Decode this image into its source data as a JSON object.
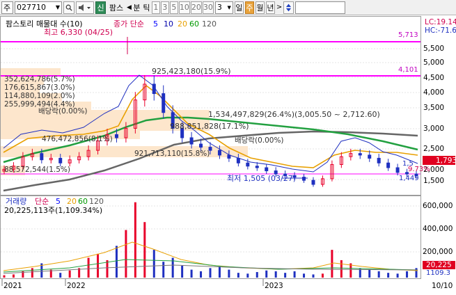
{
  "toolbar": {
    "market_label": "주",
    "code": "027710",
    "new_label": "신",
    "name": "팜스",
    "divide_label": "분",
    "tick_label": "틱",
    "intervals": [
      "1",
      "3",
      "5",
      "10",
      "20",
      "30"
    ],
    "count": "3",
    "day_label": "일",
    "week_label": "주",
    "month_label": "월",
    "year_label": "년",
    "prev_arrow": "◀",
    "next_arrow": ">"
  },
  "price_panel": {
    "legend_name": "팜스토리 매물대 수(10)",
    "legend_ma_prefix": "종가 단순",
    "ma_periods": [
      "5",
      "10",
      "20",
      "60",
      "120"
    ],
    "ma_colors": [
      "#0000ff",
      "#0000aa",
      "#e8a000",
      "#009900",
      "#555555"
    ],
    "high_label": "최고 6,330 (04/25)",
    "low_label": "최저 1,505 (03/27)",
    "lc_label": "LC:19.14",
    "hc_label": "HC:-71.6",
    "level_5713": "5,713",
    "level_4101": "4,101",
    "magenta_level_label": "925,423,180(15.9%)",
    "volume_profile": [
      "352,624,786(5.7%)",
      "176,615,867(3.0%)",
      "114,880,109(2.0%)",
      "255,999,494(4.4%)",
      "476,472,856(8.1%)",
      "921,713,110(15.8%)",
      "88,572,544(1.5%)"
    ],
    "band_label": "1,534,497,829(26.4%)(3,005.50 ~ 2,712.60)",
    "band_label2": "988,851,828(17.1%)",
    "dividend_label_1": "배당락(0.00%)",
    "dividend_label_2": "배당락(0.00%)",
    "y_ticks": [
      "5,500",
      "5,000",
      "4,500",
      "4,000",
      "3,500",
      "3,000",
      "2,500",
      "2,000",
      "1,500"
    ],
    "current_price": "1,793",
    "pct_label": "9.73%",
    "small_label_1": "1,5",
    "small_label_2": "1,449"
  },
  "volume_panel": {
    "legend_name": "거래량",
    "legend_ma_prefix": "단순",
    "ma_periods": [
      "5",
      "20",
      "60",
      "120"
    ],
    "ma_colors": [
      "#0000ff",
      "#e8a000",
      "#009900",
      "#555555"
    ],
    "last_volume_label": "20,225,113주(1,109.34%)",
    "y_ticks": [
      "600,000",
      "400,000",
      "200,000"
    ],
    "current_volume": "20,225",
    "current_pct": "1109.3"
  },
  "x_axis": {
    "labels": [
      "2021",
      "2022",
      "2023"
    ],
    "date_label": "10/10"
  },
  "chart_data": {
    "type": "line",
    "title": "",
    "series": [
      {
        "name": "종가",
        "values": [
          2000,
          2100,
          2400,
          2500,
          2300,
          2350,
          2200,
          2300,
          2400,
          2600,
          2900,
          3100,
          3000,
          3300,
          4200,
          4700,
          4400,
          3800,
          3300,
          3000,
          2800,
          2700,
          2600,
          2450,
          2350,
          2200,
          2100,
          2050,
          1950,
          1850,
          1800,
          1750,
          1650,
          1520,
          1700,
          2150,
          2400,
          2500,
          2450,
          2350,
          2200,
          2050,
          1900,
          1850,
          1793
        ]
      }
    ],
    "price_range": [
      1300,
      6200
    ],
    "volume": [
      3,
      4,
      8,
      12,
      18,
      10,
      6,
      9,
      12,
      25,
      30,
      22,
      40,
      60,
      95,
      70,
      35,
      20,
      25,
      15,
      10,
      8,
      12,
      14,
      10,
      6,
      5,
      7,
      9,
      8,
      6,
      8,
      5,
      4,
      5,
      35,
      22,
      18,
      12,
      10,
      8,
      6,
      5,
      8,
      12
    ],
    "volume_range": [
      0,
      650000
    ]
  }
}
